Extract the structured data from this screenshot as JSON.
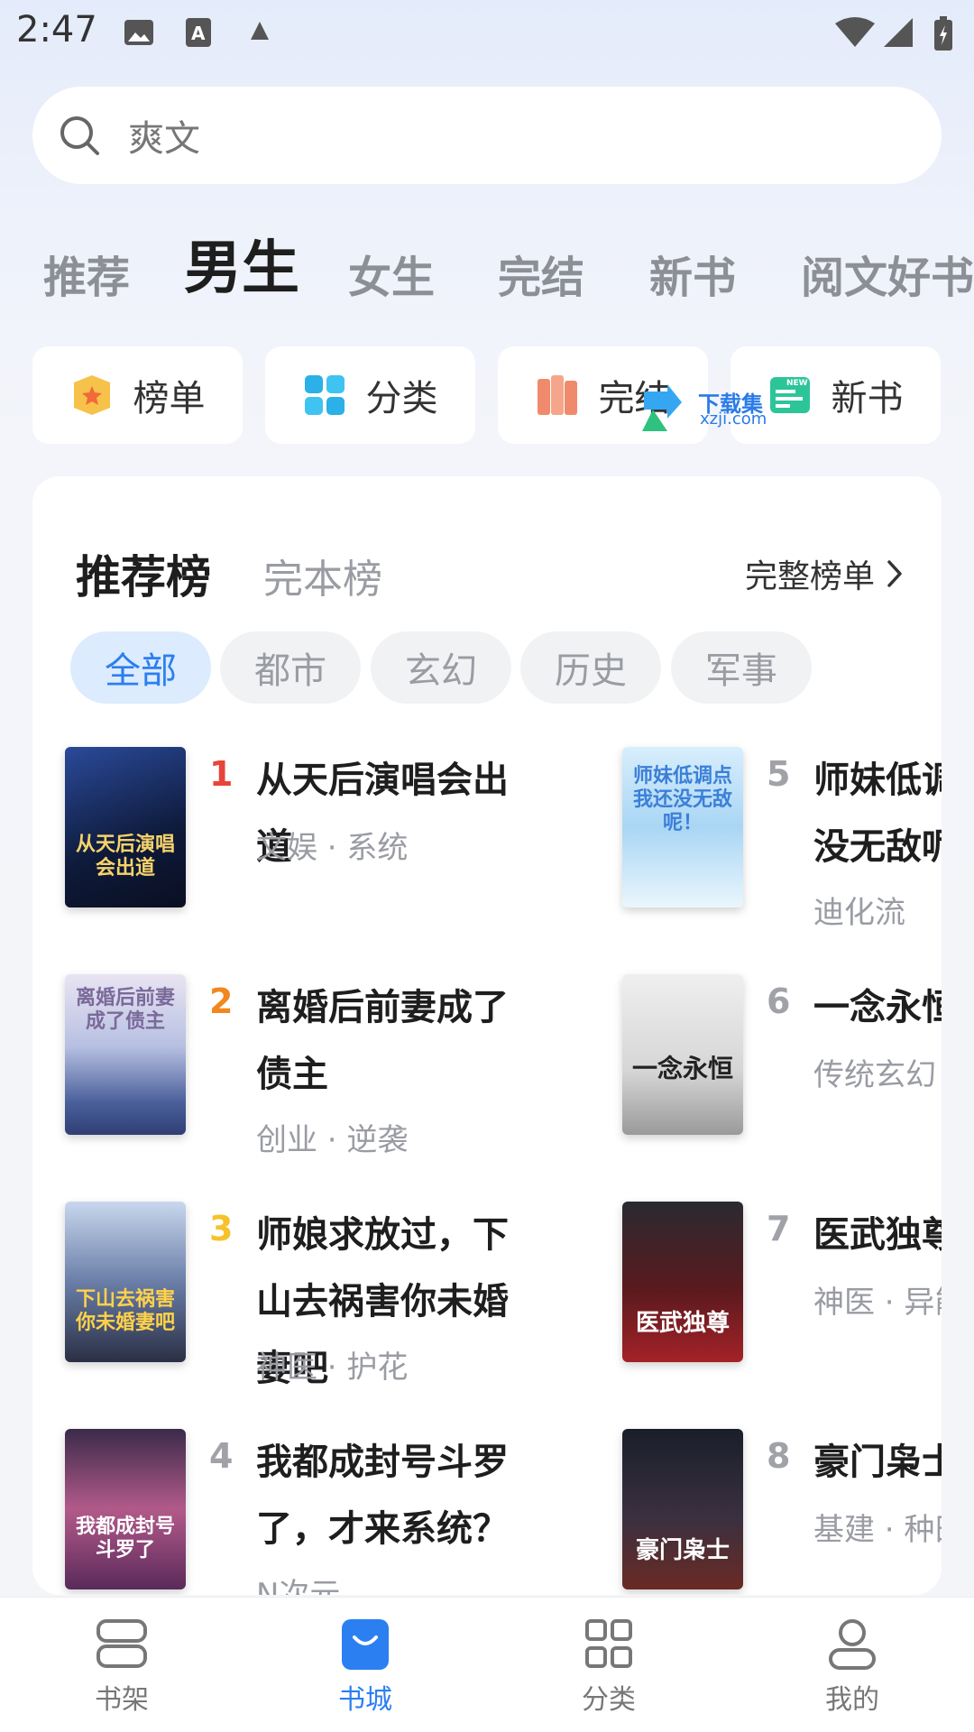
{
  "status_bar": {
    "time": "2:47"
  },
  "search": {
    "placeholder": "爽文"
  },
  "tabs": [
    {
      "label": "推荐"
    },
    {
      "label": "男生"
    },
    {
      "label": "女生"
    },
    {
      "label": "完结"
    },
    {
      "label": "新书"
    },
    {
      "label": "阅文好书"
    }
  ],
  "quick_entries": [
    {
      "label": "榜单",
      "icon": "trophy-icon"
    },
    {
      "label": "分类",
      "icon": "grid-icon"
    },
    {
      "label": "完结",
      "icon": "books-icon"
    },
    {
      "label": "新书",
      "icon": "new-badge-icon"
    }
  ],
  "watermark": {
    "text": "下载集",
    "sub": "xzji.com"
  },
  "ranking": {
    "title": "推荐榜",
    "title2": "完本榜",
    "more": "完整榜单",
    "chips": [
      "全部",
      "都市",
      "玄幻",
      "历史",
      "军事"
    ],
    "books": [
      {
        "rank": "1",
        "title": "从天后演唱会出道",
        "tags": "文娱 · 系统",
        "cover_text": "从天后演唱会出道"
      },
      {
        "rank": "2",
        "title": "离婚后前妻成了债主",
        "tags": "创业 · 逆袭",
        "cover_text": "离婚后前妻成了债主"
      },
      {
        "rank": "3",
        "title": "师娘求放过，下山去祸害你未婚妻吧",
        "tags": "神医 · 护花",
        "cover_text": "下山去祸害你未婚妻吧"
      },
      {
        "rank": "4",
        "title": "我都成封号斗罗了，才来系统？",
        "tags": "N次元",
        "cover_text": "我都成封号斗罗了"
      },
      {
        "rank": "5",
        "title": "师妹低调点我还没无敌呢",
        "tags": "迪化流",
        "cover_text": "师妹低调点我还没无敌呢！"
      },
      {
        "rank": "6",
        "title": "一念永恒",
        "tags": "传统玄幻",
        "cover_text": "一念永恒"
      },
      {
        "rank": "7",
        "title": "医武独尊",
        "tags": "神医 · 异能",
        "cover_text": "医武独尊"
      },
      {
        "rank": "8",
        "title": "豪门枭士",
        "tags": "基建 · 种田",
        "cover_text": "豪门枭士"
      }
    ]
  },
  "bottom_nav": [
    {
      "label": "书架"
    },
    {
      "label": "书城"
    },
    {
      "label": "分类"
    },
    {
      "label": "我的"
    }
  ]
}
